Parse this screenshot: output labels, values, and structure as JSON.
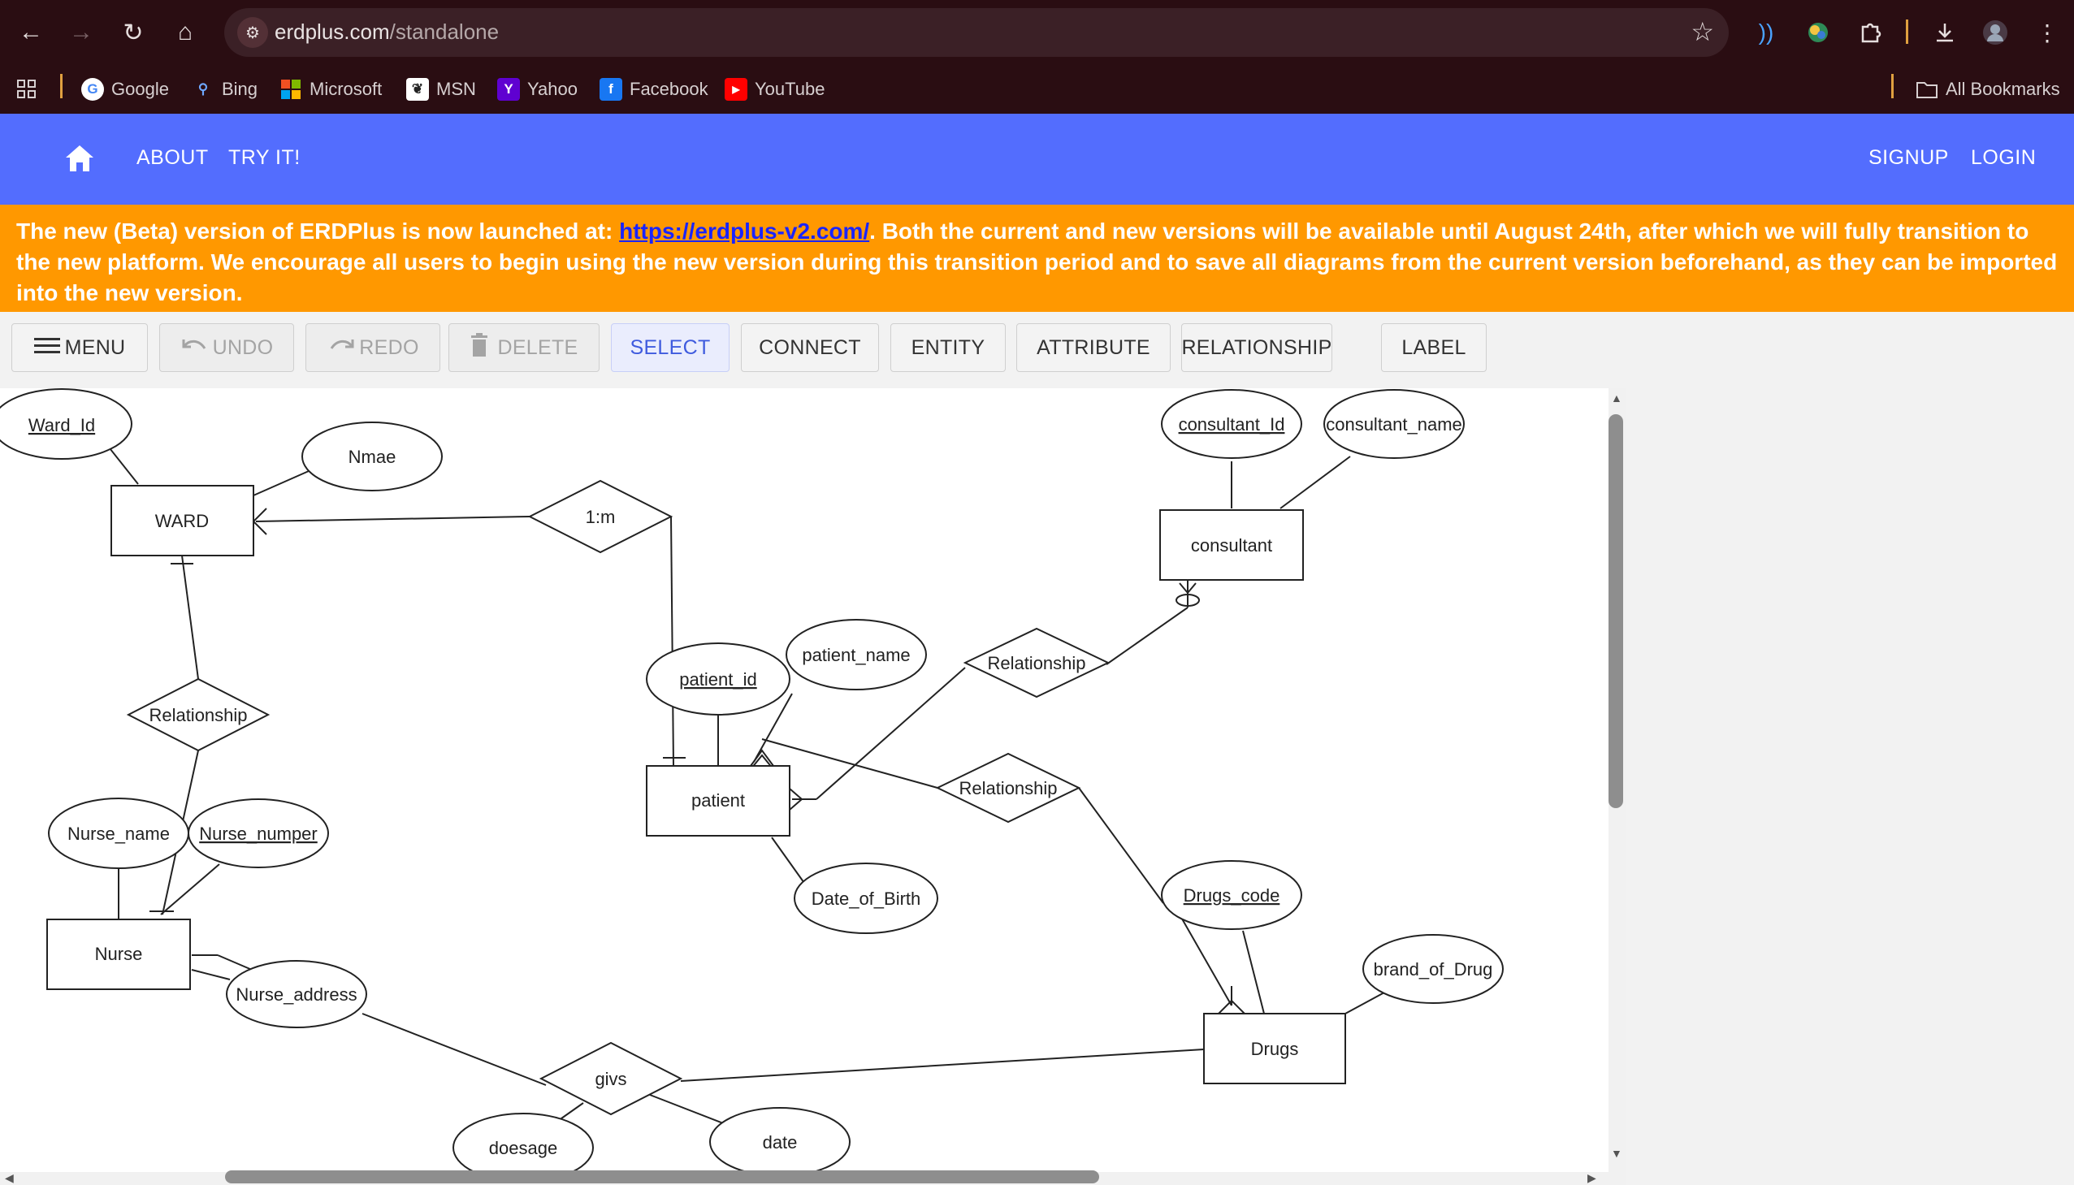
{
  "browser": {
    "url_domain": "erdplus.com",
    "url_path": "/standalone",
    "bookmarks": [
      {
        "label": "Google",
        "icon": "google-icon"
      },
      {
        "label": "Bing",
        "icon": "bing-search-icon"
      },
      {
        "label": "Microsoft",
        "icon": "microsoft-icon"
      },
      {
        "label": "MSN",
        "icon": "msn-icon"
      },
      {
        "label": "Yahoo",
        "icon": "yahoo-icon"
      },
      {
        "label": "Facebook",
        "icon": "facebook-icon"
      },
      {
        "label": "YouTube",
        "icon": "youtube-icon"
      }
    ],
    "all_bookmarks": "All Bookmarks"
  },
  "header": {
    "about": "ABOUT",
    "try_it": "TRY IT!",
    "signup": "SIGNUP",
    "login": "LOGIN",
    "color": "#536dfe"
  },
  "notice": {
    "text_before": "The new (Beta) version of ERDPlus is now launched at: ",
    "link": "https://erdplus-v2.com/",
    "text_after": ". Both the current and new versions will be available until August 24th, after which we will fully transition to the new platform. We encourage all users to begin using the new version during this transition period and to save all diagrams from the current version beforehand, as they can be imported into the new version.",
    "color": "#ff9800"
  },
  "toolbar": {
    "menu": "MENU",
    "undo": "UNDO",
    "redo": "REDO",
    "delete": "DELETE",
    "select": "SELECT",
    "connect": "CONNECT",
    "entity": "ENTITY",
    "attribute": "ATTRIBUTE",
    "relationship": "RELATIONSHIP",
    "label": "LABEL"
  },
  "diagram": {
    "entities": {
      "ward": "WARD",
      "consultant": "consultant",
      "patient": "patient",
      "nurse": "Nurse",
      "drugs": "Drugs"
    },
    "attributes": {
      "ward_id": "Ward_Id",
      "nmae": "Nmae",
      "consultant_id": "consultant_Id",
      "consultant_name": "consultant_name",
      "patient_id": "patient_id",
      "patient_name": "patient_name",
      "nurse_name": "Nurse_name",
      "nurse_number": "Nurse_numper",
      "date_of_birth": "Date_of_Birth",
      "drugs_code": "Drugs_code",
      "brand_of_drug": "brand_of_Drug",
      "nurse_address": "Nurse_address",
      "doesage": "doesage",
      "date": "date"
    },
    "relationships": {
      "ward_patient": "1:m",
      "ward_nurse": "Relationship",
      "patient_consultant": "Relationship",
      "patient_drugs": "Relationship",
      "nurse_drugs": "givs"
    }
  }
}
